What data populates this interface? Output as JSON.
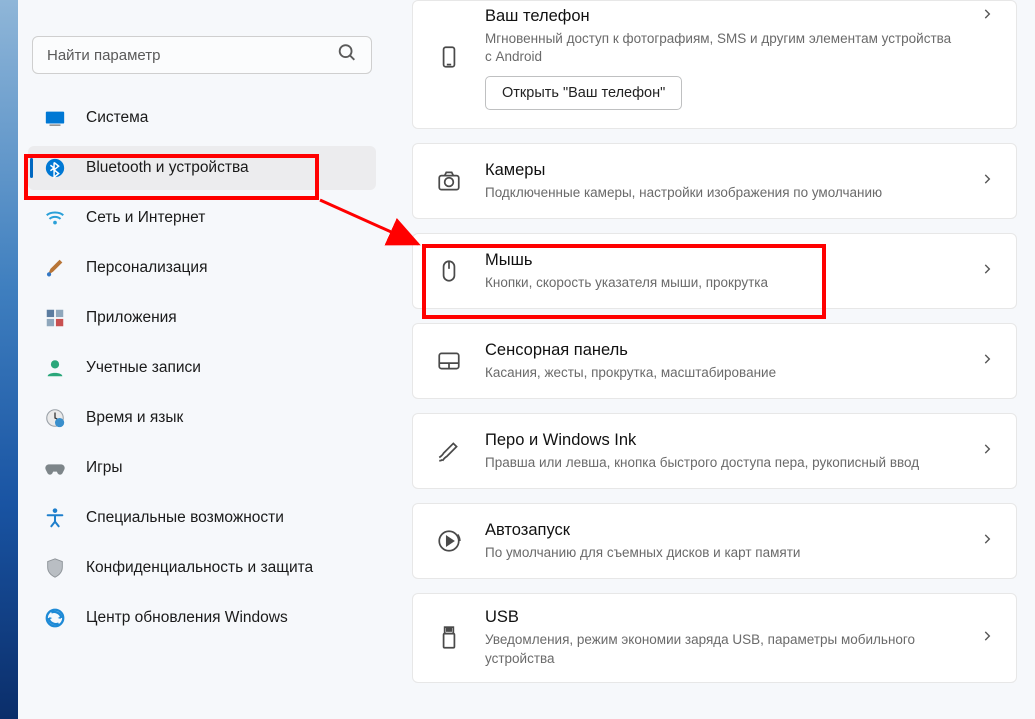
{
  "search": {
    "placeholder": "Найти параметр"
  },
  "sidebar": {
    "items": [
      {
        "label": "Система"
      },
      {
        "label": "Bluetooth и устройства"
      },
      {
        "label": "Сеть и Интернет"
      },
      {
        "label": "Персонализация"
      },
      {
        "label": "Приложения"
      },
      {
        "label": "Учетные записи"
      },
      {
        "label": "Время и язык"
      },
      {
        "label": "Игры"
      },
      {
        "label": "Специальные возможности"
      },
      {
        "label": "Конфиденциальность и защита"
      },
      {
        "label": "Центр обновления Windows"
      }
    ]
  },
  "cards": {
    "phone": {
      "title": "Ваш телефон",
      "sub": "Мгновенный доступ к фотографиям, SMS и другим элементам устройства с Android",
      "button": "Открыть \"Ваш телефон\""
    },
    "cameras": {
      "title": "Камеры",
      "sub": "Подключенные камеры, настройки изображения по умолчанию"
    },
    "mouse": {
      "title": "Мышь",
      "sub": "Кнопки, скорость указателя мыши, прокрутка"
    },
    "touchpad": {
      "title": "Сенсорная панель",
      "sub": "Касания, жесты, прокрутка, масштабирование"
    },
    "pen": {
      "title": "Перо и Windows Ink",
      "sub": "Правша или левша, кнопка быстрого доступа пера, рукописный ввод"
    },
    "autoplay": {
      "title": "Автозапуск",
      "sub": "По умолчанию для съемных дисков и карт памяти"
    },
    "usb": {
      "title": "USB",
      "sub": "Уведомления, режим экономии заряда USB, параметры мобильного устройства"
    }
  }
}
